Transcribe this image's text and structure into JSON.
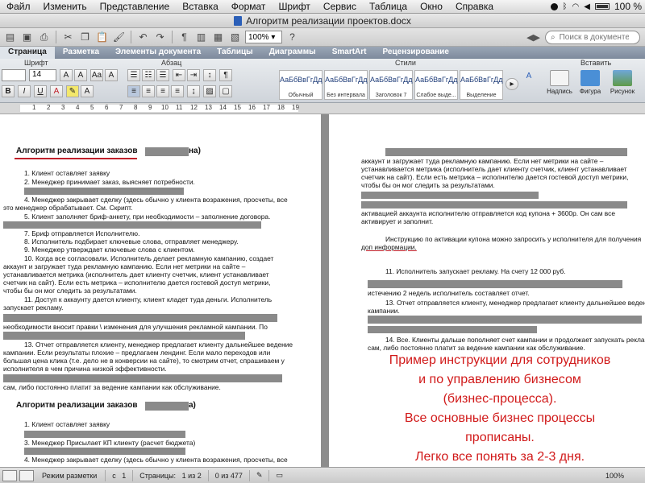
{
  "menubar": {
    "items": [
      "Файл",
      "Изменить",
      "Представление",
      "Вставка",
      "Формат",
      "Шрифт",
      "Сервис",
      "Таблица",
      "Окно",
      "Справка"
    ],
    "battery": "100 %"
  },
  "window": {
    "title": "Алгоритм реализации проектов.docx"
  },
  "toolbar": {
    "zoom": "100%",
    "search_placeholder": "Поиск в документе"
  },
  "ribbon_tabs": [
    "Страница",
    "Разметка",
    "Элементы документа",
    "Таблицы",
    "Диаграммы",
    "SmartArt",
    "Рецензирование"
  ],
  "ribbon": {
    "font_group": "Шрифт",
    "paragraph_group": "Абзац",
    "styles_group": "Стили",
    "insert_group": "Вставить",
    "font_size": "14",
    "styles": [
      {
        "sample": "АаБбВвГгДд",
        "name": "Обычный"
      },
      {
        "sample": "АаБбВвГгДд",
        "name": "Без интервала"
      },
      {
        "sample": "АаБбВвГгДд",
        "name": "Заголовок 7"
      },
      {
        "sample": "АаБбВвГгДд",
        "name": "Слабое выде..."
      },
      {
        "sample": "АаБбВвГгДд",
        "name": "Выделение"
      }
    ],
    "insert_buttons": [
      "Надпись",
      "Фигура",
      "Рисунок"
    ]
  },
  "ruler": {
    "numbers": [
      "1",
      "2",
      "3",
      "4",
      "5",
      "6",
      "7",
      "8",
      "9",
      "10",
      "11",
      "12",
      "13",
      "14",
      "15",
      "16",
      "17",
      "18",
      "19"
    ]
  },
  "left_page": {
    "heading1": "Алгоритм реализации заказов",
    "heading1_tail": "на)",
    "lines": [
      "1. Клиент оставляет заявку",
      "2. Менеджер принимает заказ, выясняет потребности.",
      "4. Менеджер закрывает сделку (здесь обычно у клиента возражения, просчеты, все",
      "это менеджер обрабатывает. См. Скрипт.",
      "5. Клиент заполняет бриф-анкету, при необходимости – заполнение договора.",
      "7. Бриф отправляется Исполнителю.",
      "8. Исполнитель подбирает ключевые слова, отправляет менеджеру.",
      "9. Менеджер утверждает ключевые слова с клиентом.",
      "10. Когда все согласовали. Исполнитель делает рекламную кампанию, создает",
      "аккаунт и загружает туда рекламную кампанию. Если нет метрики на сайте –",
      "устанавливается метрика (исполнитель дает клиенту счетчик, клиент устанавливает",
      "счетчик на сайт). Если есть метрика – исполнителю дается гостевой доступ метрики,",
      "чтобы бы он мог следить за результатами.",
      "11. Доступ к аккаунту дается клиенту, клиент кладет туда деньги. Исполнитель",
      "запускает рекламу.",
      "необходимости вносит правки \\ изменения для улучшения рекламной кампании. По",
      "13. Отчет отправляется клиенту, менеджер предлагает клиенту дальнейшее ведение",
      "кампании. Если результаты плохие – предлагаем лендинг. Если мало переходов или",
      "большая цена клика (т.е. дело не в конверсии на сайте), то смотрим отчет, спрашиваем у",
      "исполнителя в чем причина низкой эффективности.",
      "сам, либо постоянно платит за ведение кампании как обслуживание."
    ],
    "heading2": "Алгоритм реализации заказов",
    "heading2_tail": "а)",
    "lines2": [
      "1. Клиент оставляет заявку",
      "3. Менеджер Присылает КП клиенту (расчет бюджета)",
      "4. Менеджер закрывает сделку (здесь обычно у клиента возражения, просчеты, все",
      "это менеджер обрабатывает. См. Скрипт."
    ]
  },
  "right_page": {
    "lines": [
      "аккаунт и загружает туда рекламную кампанию. Если нет метрики на сайте –",
      "устанавливается метрика (исполнитель дает клиенту счетчик, клиент устанавливает",
      "счетчик на сайт). Если есть метрика – исполнителю дается гостевой доступ метрики,",
      "чтобы бы он мог следить за результатами.",
      "активацией аккаунта исполнителю отправляется код купона + 3600р. Он сам все",
      "активирует и заполнит.",
      "Инструкцию по активации купона можно запросить у исполнителя для получения",
      "доп информации.",
      "11. Исполнитель запускает рекламу. На счету 12 000 руб.",
      "истечению 2 недель исполнитель составляет отчет.",
      "13. Отчет отправляется клиенту, менеджер предлагает клиенту дальнейшее ведение",
      "кампании.",
      "14. Все. Клиенты дальше пополняет счет кампании и продолжает запускать рекламу",
      "сам, либо постоянно платит за ведение кампании как обслуживание."
    ],
    "overlay": [
      "Пример инструкции для сотрудников",
      "и по управлению бизнесом",
      "(бизнес-процесса).",
      "Все основные бизнес процессы",
      "прописаны.",
      "Легко все понять за 2-3 дня."
    ]
  },
  "statusbar": {
    "view": "Режим разметки",
    "section_label": "с",
    "section": "1",
    "pages_label": "Страницы:",
    "pages": "1 из 2",
    "words": "0 из 477",
    "zoom": "100%"
  }
}
